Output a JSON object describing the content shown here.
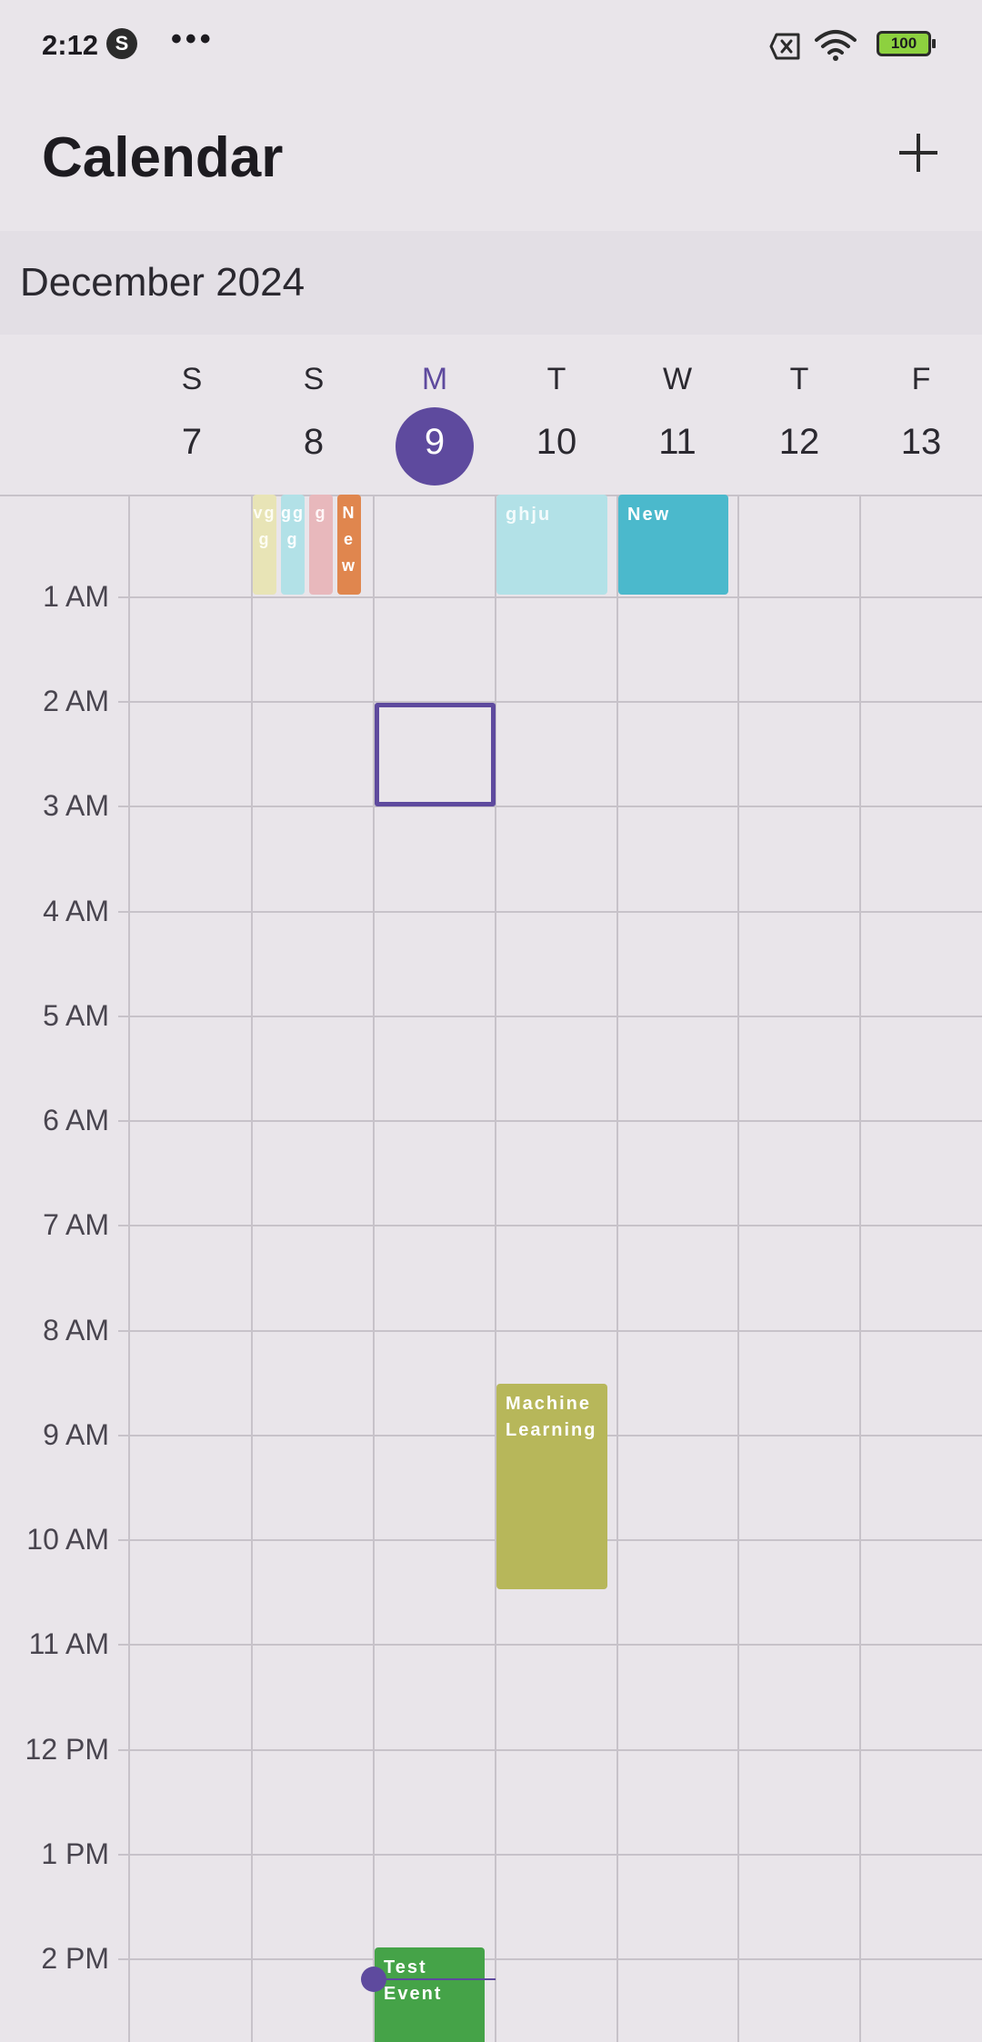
{
  "status_bar": {
    "time": "2:12",
    "app_icon_glyph": "S",
    "overflow": "•••",
    "battery": "100"
  },
  "app_bar": {
    "title": "Calendar",
    "add_icon": "plus-icon"
  },
  "month": {
    "label": "December 2024"
  },
  "week": {
    "days": [
      {
        "letter": "S",
        "number": "7"
      },
      {
        "letter": "S",
        "number": "8"
      },
      {
        "letter": "M",
        "number": "9"
      },
      {
        "letter": "T",
        "number": "10"
      },
      {
        "letter": "W",
        "number": "11"
      },
      {
        "letter": "T",
        "number": "12"
      },
      {
        "letter": "F",
        "number": "13"
      }
    ],
    "today_index": 2,
    "accent_color": "#5e4a9e"
  },
  "hours": [
    "1 AM",
    "2 AM",
    "3 AM",
    "4 AM",
    "5 AM",
    "6 AM",
    "7 AM",
    "8 AM",
    "9 AM",
    "10 AM",
    "11 AM",
    "12 PM",
    "1 PM",
    "2 PM"
  ],
  "events": [
    {
      "title": "vgg",
      "day": "8",
      "color": "#e8e4b6"
    },
    {
      "title": "ggg",
      "day": "8",
      "color": "#b2e1e7"
    },
    {
      "title": "g",
      "day": "8",
      "color": "#e8b8bc"
    },
    {
      "title": "New",
      "day": "8",
      "color": "#e0864e"
    },
    {
      "title": "ghju",
      "day": "10",
      "color": "#b2e1e7"
    },
    {
      "title": "New",
      "day": "11",
      "color": "#4bb9cc"
    },
    {
      "title": "Machine Learning",
      "day": "10",
      "color": "#b7b75a"
    },
    {
      "title": "Test Event",
      "day": "9",
      "color": "#45a348"
    }
  ]
}
